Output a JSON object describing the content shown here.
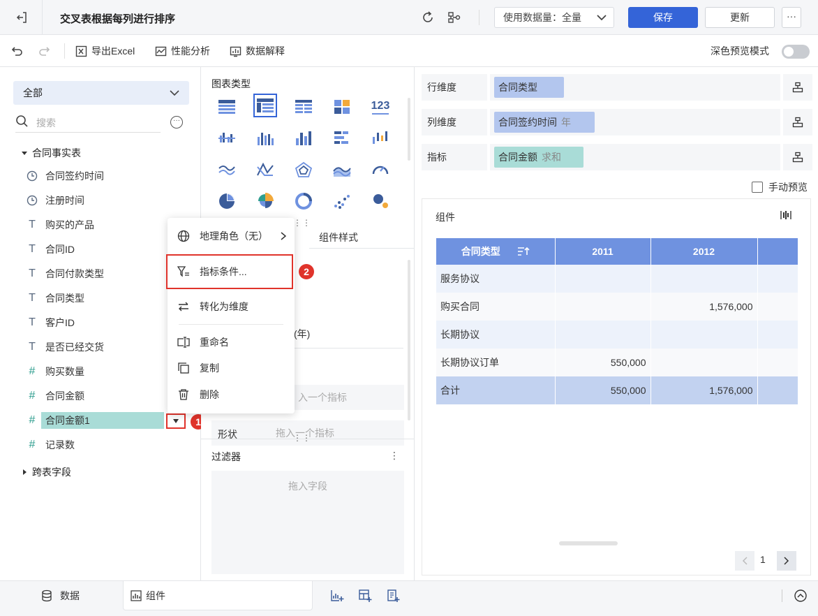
{
  "header": {
    "title": "交叉表根据每列进行排序",
    "data_usage": "使用数据量：全量",
    "save_label": "保存",
    "update_label": "更新",
    "more_label": "···"
  },
  "toolbar": {
    "export_excel": "导出Excel",
    "perf_analysis": "性能分析",
    "data_explain": "数据解释",
    "dark_preview": "深色预览模式"
  },
  "left": {
    "scope": "全部",
    "search_placeholder": "搜索",
    "table_name": "合同事实表",
    "fields": [
      {
        "label": "合同签约时间",
        "icon": "clock-icon"
      },
      {
        "label": "注册时间",
        "icon": "clock-icon"
      },
      {
        "label": "购买的产品",
        "icon": "text-type-icon"
      },
      {
        "label": "合同ID",
        "icon": "text-type-icon"
      },
      {
        "label": "合同付款类型",
        "icon": "text-type-icon"
      },
      {
        "label": "合同类型",
        "icon": "text-type-icon"
      },
      {
        "label": "客户ID",
        "icon": "text-type-icon"
      },
      {
        "label": "是否已经交货",
        "icon": "text-type-icon"
      },
      {
        "label": "购买数量",
        "icon": "number-type-icon"
      },
      {
        "label": "合同金额",
        "icon": "number-type-icon"
      },
      {
        "label": "合同金额1",
        "icon": "number-type-icon"
      },
      {
        "label": "记录数",
        "icon": "number-type-icon"
      }
    ],
    "cross_fields": "跨表字段",
    "badge1": "1",
    "badge2": "2"
  },
  "menu": {
    "items": [
      "地理角色（无）",
      "指标条件...",
      "转化为维度",
      "重命名",
      "复制",
      "删除"
    ]
  },
  "middle": {
    "chart_type_title": "图表类型",
    "chart_tile_label": "123",
    "tab_style": "组件样式",
    "fragment_year": "(年)",
    "drop_metric_1": "入一个指标",
    "shape_label": "形状",
    "drop_metric_2": "拖入一个指标",
    "filter_title": "过滤器",
    "filter_dots": "⋮",
    "filter_drop": "拖入字段"
  },
  "right": {
    "row_dim_label": "行维度",
    "row_dim_value": "合同类型",
    "col_dim_label": "列维度",
    "col_dim_value": "合同签约时间",
    "col_dim_sub": "年",
    "metric_label": "指标",
    "metric_value": "合同金额",
    "metric_sub": "求和",
    "manual_preview": "手动预览",
    "component_title": "组件",
    "table": {
      "headers": [
        "合同类型",
        "2011",
        "2012",
        ""
      ],
      "rows": [
        [
          "服务协议",
          "",
          "",
          ""
        ],
        [
          "购买合同",
          "",
          "1,576,000",
          ""
        ],
        [
          "长期协议",
          "",
          "",
          ""
        ],
        [
          "长期协议订单",
          "550,000",
          "",
          ""
        ]
      ],
      "total": [
        "合计",
        "550,000",
        "1,576,000",
        ""
      ]
    },
    "page": "1"
  },
  "bottom": {
    "tab_data": "数据",
    "tab_component": "组件"
  },
  "colors": {
    "primary": "#3464d8",
    "header_blue": "#6f92e0",
    "dim_pill": "#b3c6ee",
    "metric_pill": "#a9dcd7",
    "highlight_red": "#e0332b"
  }
}
